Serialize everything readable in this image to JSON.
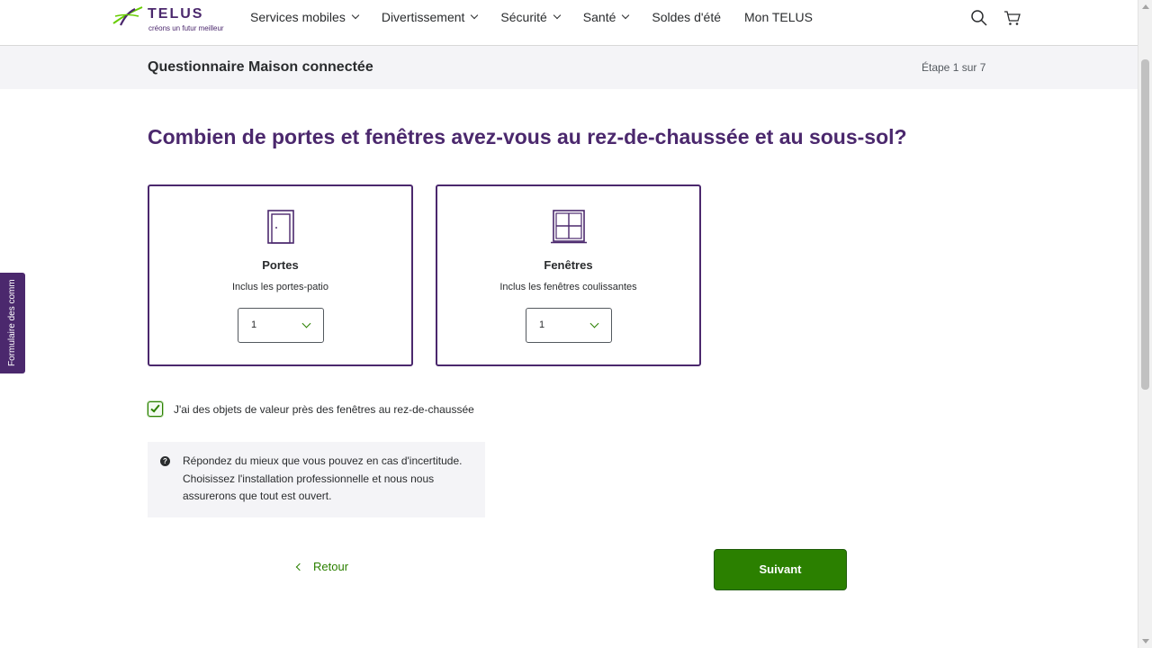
{
  "brand": {
    "wordmark": "TELUS",
    "tagline": "créons un futur meilleur",
    "colors": {
      "purple": "#4b286d",
      "green": "#2b8000",
      "light_green": "#66cc00"
    }
  },
  "nav": {
    "items": [
      {
        "label": "Services mobiles",
        "has_dropdown": true
      },
      {
        "label": "Divertissement",
        "has_dropdown": true
      },
      {
        "label": "Sécurité",
        "has_dropdown": true
      },
      {
        "label": "Santé",
        "has_dropdown": true
      },
      {
        "label": "Soldes d'été",
        "has_dropdown": false
      },
      {
        "label": "Mon TELUS",
        "has_dropdown": false
      }
    ],
    "icons": [
      "search-icon",
      "cart-icon"
    ]
  },
  "subheader": {
    "title": "Questionnaire Maison connectée",
    "step": "Étape 1 sur 7"
  },
  "question": "Combien de portes et fenêtres avez-vous au rez-de-chaussée et au sous-sol?",
  "cards": [
    {
      "icon": "door-icon",
      "title": "Portes",
      "subtitle": "Inclus les portes-patio",
      "value": "1"
    },
    {
      "icon": "window-icon",
      "title": "Fenêtres",
      "subtitle": "Inclus les fenêtres coulissantes",
      "value": "1"
    }
  ],
  "checkbox": {
    "checked": true,
    "label": "J'ai des objets de valeur près des fenêtres au rez-de-chaussée"
  },
  "info": {
    "icon": "question-icon",
    "text": "Répondez du mieux que vous pouvez en cas d'incertitude. Choisissez l'installation professionnelle et nous nous assurerons que tout est ouvert."
  },
  "actions": {
    "back_label": "Retour",
    "next_label": "Suivant"
  },
  "feedback_tab": "Formulaire des commentaires"
}
